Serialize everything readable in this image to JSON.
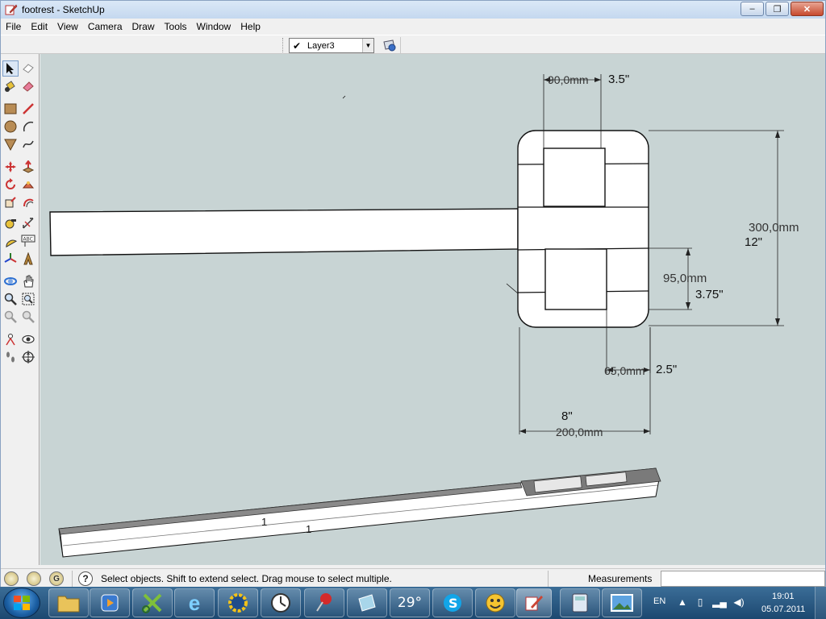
{
  "window": {
    "title": "footrest - SketchUp",
    "controls": {
      "minimize": "–",
      "maximize": "❐",
      "close": "✕"
    }
  },
  "menu": [
    "File",
    "Edit",
    "View",
    "Camera",
    "Draw",
    "Tools",
    "Window",
    "Help"
  ],
  "toolbar": {
    "layer_check": "✔",
    "layer_name": "Layer3",
    "layer_arrow": "▼"
  },
  "tools": [
    "select-icon",
    "eraser-icon",
    "paint-bucket-icon",
    "eraser-pink-icon",
    "rectangle-icon",
    "line-icon",
    "circle-icon",
    "arc-icon",
    "polygon-icon",
    "freehand-icon",
    "move-icon",
    "push-pull-icon",
    "rotate-icon",
    "follow-me-icon",
    "scale-icon",
    "offset-icon",
    "tape-measure-icon",
    "dimension-icon",
    "protractor-icon",
    "text-icon",
    "axes-icon",
    "3d-text-icon",
    "orbit-icon",
    "pan-icon",
    "zoom-icon",
    "zoom-window-icon",
    "previous-view-icon",
    "next-view-icon",
    "position-camera-icon",
    "look-around-icon",
    "walk-icon",
    "section-plane-icon"
  ],
  "drawing": {
    "dimensions": {
      "top_mm": "90,0mm",
      "top_in": "3.5\"",
      "height_mm": "300,0mm",
      "height_in": "12\"",
      "slot_mm": "95,0mm",
      "slot_in": "3.75\"",
      "gap_mm": "65,0mm",
      "gap_in": "2.5\"",
      "width_in": "8\"",
      "width_mm": "200,0mm"
    },
    "rail_label_1": "1",
    "rail_label_2": "1"
  },
  "status": {
    "geo_icons": [
      "",
      "",
      "G"
    ],
    "help": "?",
    "text": "Select objects. Shift to extend select. Drag mouse to select multiple.",
    "measurements_label": "Measurements",
    "measurements_value": ""
  },
  "taskbar": {
    "weather": "29°",
    "language": "EN",
    "time": "19:01",
    "date": "05.07.2011"
  }
}
